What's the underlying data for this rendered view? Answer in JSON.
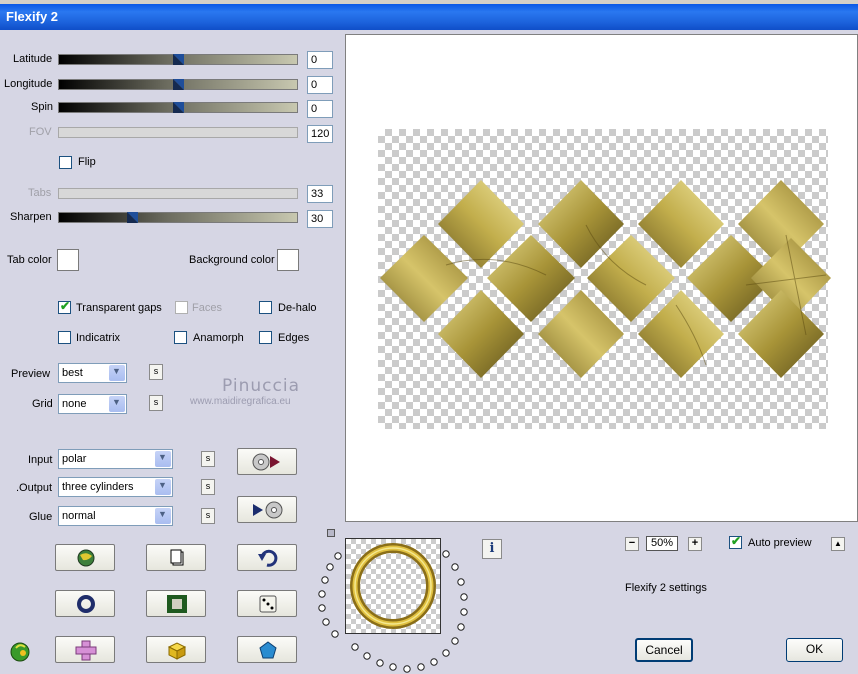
{
  "window": {
    "title": "Flexify 2"
  },
  "sliders": [
    {
      "label": "Latitude",
      "value": "0",
      "position": 0.5,
      "enabled": true
    },
    {
      "label": "Longitude",
      "value": "0",
      "position": 0.5,
      "enabled": true
    },
    {
      "label": "Spin",
      "value": "0",
      "position": 0.5,
      "enabled": true
    },
    {
      "label": "FOV",
      "value": "120",
      "enabled": false
    },
    {
      "label": "Tabs",
      "value": "33",
      "enabled": false
    },
    {
      "label": "Sharpen",
      "value": "30",
      "position": 0.3,
      "enabled": true
    }
  ],
  "flip": {
    "label": "Flip",
    "checked": false
  },
  "colors": {
    "tab_label": "Tab color",
    "tab_value": "#ffffff",
    "bg_label": "Background color",
    "bg_value": "#ffffff"
  },
  "checkboxes": [
    {
      "label": "Transparent gaps",
      "checked": true,
      "enabled": true
    },
    {
      "label": "Faces",
      "checked": false,
      "enabled": false
    },
    {
      "label": "De-halo",
      "checked": false,
      "enabled": true
    },
    {
      "label": "Indicatrix",
      "checked": false,
      "enabled": true
    },
    {
      "label": "Anamorph",
      "checked": false,
      "enabled": true
    },
    {
      "label": "Edges",
      "checked": false,
      "enabled": true
    }
  ],
  "preview": {
    "label": "Preview",
    "value": "best"
  },
  "grid": {
    "label": "Grid",
    "value": "none"
  },
  "input": {
    "label": "Input",
    "value": "polar"
  },
  "output": {
    "label": ".Output",
    "value": "three cylinders"
  },
  "glue": {
    "label": "Glue",
    "value": "normal"
  },
  "s_label": "s",
  "watermark": {
    "name": "Pinuccia",
    "site": "www.maidiregrafica.eu"
  },
  "zoom": {
    "value": "50%",
    "minus": "−",
    "plus": "+"
  },
  "auto_preview": {
    "label": "Auto preview",
    "checked": true
  },
  "settings_label": "Flexify 2 settings",
  "info_label": "i",
  "collapse_label": "▲",
  "buttons": {
    "cancel": "Cancel",
    "ok": "OK"
  },
  "accent": {
    "title_blue": "#0a58e6",
    "check_green": "#21a121",
    "thumb_blue": "#1f4e9a"
  }
}
